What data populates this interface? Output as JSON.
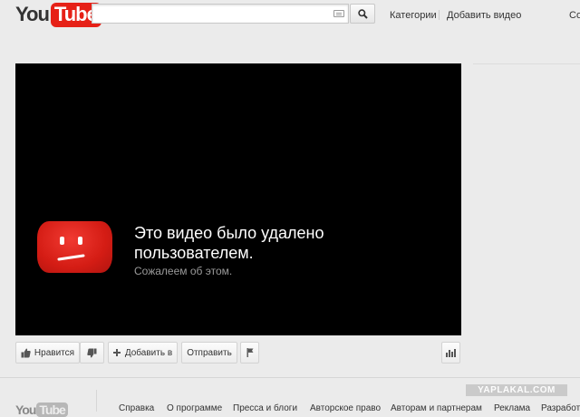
{
  "header": {
    "logo_you": "You",
    "logo_tube": "Tube",
    "search_placeholder": "",
    "categories_label": "Категории",
    "add_video_label": "Добавить видео",
    "cut_label": "Со"
  },
  "player": {
    "message_title": "Это видео было удалено пользователем.",
    "message_subtitle": "Сожалеем об этом."
  },
  "actions": {
    "like_label": "Нравится",
    "add_to_label": "Добавить в",
    "share_label": "Отправить"
  },
  "footer": {
    "links": [
      "Справка",
      "О программе",
      "Пресса и блоги",
      "Авторское право",
      "Авторам и партнерам",
      "Реклама",
      "Разработ"
    ],
    "watermark": "YAPLAKAL.COM"
  },
  "colors": {
    "brand_red": "#e62117",
    "player_bg": "#000000",
    "page_bg": "#ebebeb"
  },
  "icons": [
    "search-icon",
    "keyboard-icon",
    "thumbs-up-icon",
    "thumbs-down-icon",
    "plus-icon",
    "flag-icon",
    "stats-icon",
    "sad-tv-icon"
  ]
}
